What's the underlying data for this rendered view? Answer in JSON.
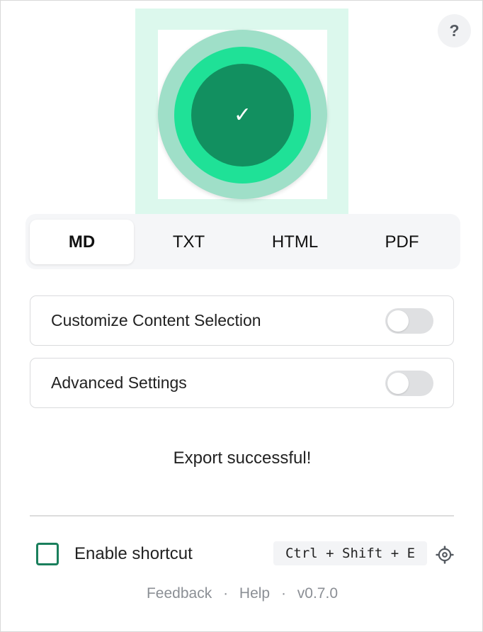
{
  "header": {
    "help_label": "?"
  },
  "hero": {
    "check_glyph": "✓",
    "icon": "check-icon",
    "colors": {
      "outer_ring": "#9fdfc8",
      "middle_ring": "#1fe197",
      "core": "#129060"
    }
  },
  "format_tabs": {
    "items": [
      {
        "label": "MD",
        "active": true
      },
      {
        "label": "TXT",
        "active": false
      },
      {
        "label": "HTML",
        "active": false
      },
      {
        "label": "PDF",
        "active": false
      }
    ]
  },
  "settings": {
    "items": [
      {
        "label": "Customize Content Selection",
        "enabled": false
      },
      {
        "label": "Advanced Settings",
        "enabled": false
      }
    ]
  },
  "status": {
    "message": "Export successful!"
  },
  "shortcut": {
    "label": "Enable shortcut",
    "checked": false,
    "keys": "Ctrl + Shift + E",
    "settings_icon": "gear-icon",
    "accent_color": "#1a7f5c"
  },
  "footer": {
    "feedback_label": "Feedback",
    "separator": "·",
    "help_label": "Help",
    "version": "v0.7.0"
  }
}
